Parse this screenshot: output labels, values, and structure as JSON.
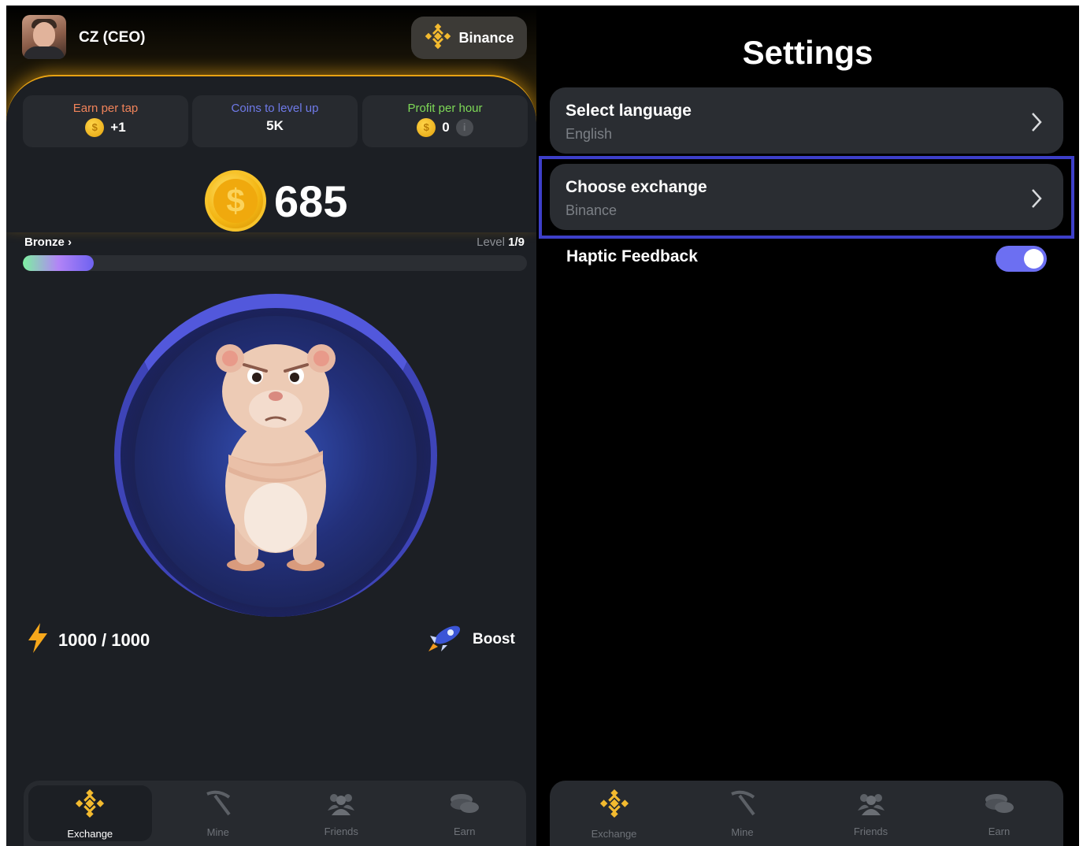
{
  "left": {
    "user": {
      "name": "CZ (CEO)"
    },
    "exchange_button": {
      "label": "Binance"
    },
    "stats": [
      {
        "title": "Earn per tap",
        "value": "+1",
        "color": "#f0835a"
      },
      {
        "title": "Coins to level up",
        "value": "5K",
        "color": "#6f7ae8"
      },
      {
        "title": "Profit per hour",
        "value": "0",
        "color": "#7ed957"
      }
    ],
    "balance": "685",
    "league": "Bronze",
    "level_prefix": "Level",
    "level_value": "1/9",
    "level_progress_fraction": 0.14,
    "energy": "1000 / 1000",
    "boost": "Boost",
    "nav": [
      {
        "label": "Exchange",
        "icon": "binance-icon",
        "active": true
      },
      {
        "label": "Mine",
        "icon": "pickaxe-icon",
        "active": false
      },
      {
        "label": "Friends",
        "icon": "friends-icon",
        "active": false
      },
      {
        "label": "Earn",
        "icon": "coins-icon",
        "active": false
      }
    ]
  },
  "right": {
    "title": "Settings",
    "rows": [
      {
        "title": "Select language",
        "value": "English"
      },
      {
        "title": "Choose exchange",
        "value": "Binance"
      }
    ],
    "haptic": {
      "label": "Haptic Feedback",
      "enabled": true
    },
    "nav": [
      {
        "label": "Exchange",
        "icon": "binance-icon",
        "active": true
      },
      {
        "label": "Mine",
        "icon": "pickaxe-icon",
        "active": false
      },
      {
        "label": "Friends",
        "icon": "friends-icon",
        "active": false
      },
      {
        "label": "Earn",
        "icon": "coins-icon",
        "active": false
      }
    ]
  },
  "colors": {
    "binance_yellow": "#f3ba2f",
    "highlight_border": "#3d3fc9",
    "toggle_on": "#6c6ff2"
  }
}
